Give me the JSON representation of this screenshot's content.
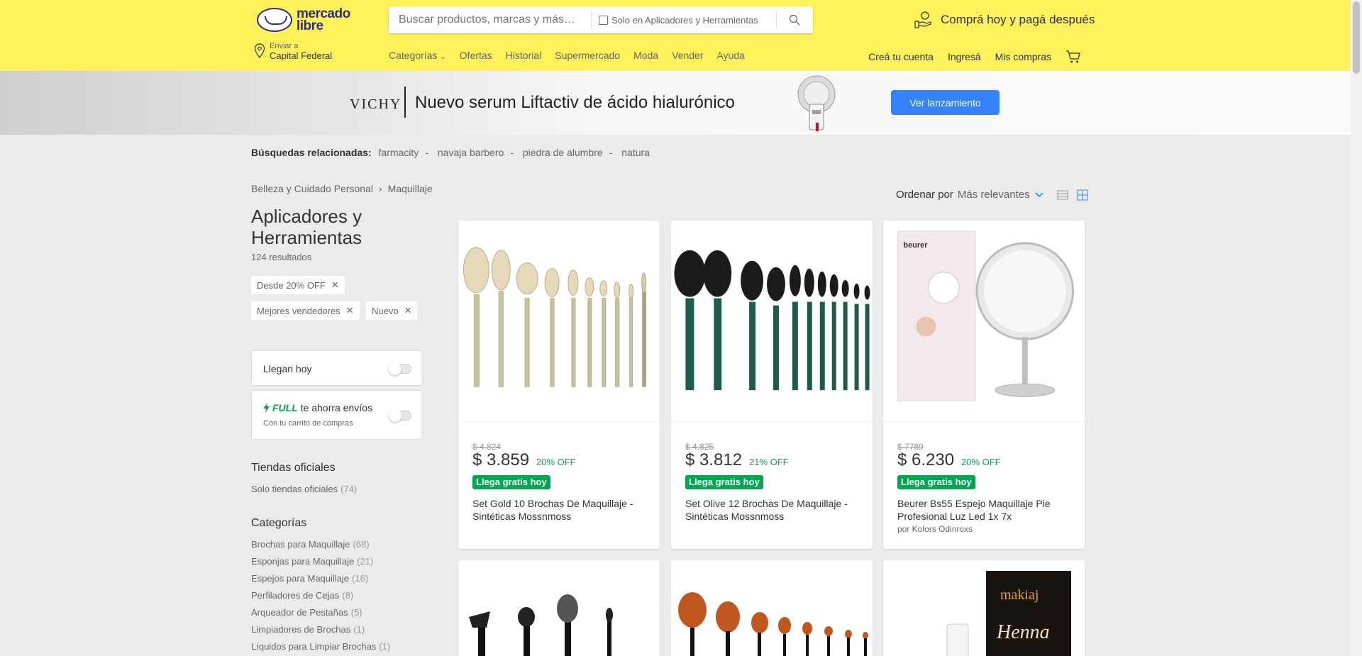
{
  "header": {
    "logo_text_1": "mercado",
    "logo_text_2": "libre",
    "search_placeholder": "Buscar productos, marcas y más…",
    "search_scope_label": "Solo en Aplicadores y Herramientas",
    "promo_text": "Comprá hoy y pagá después",
    "location_small": "Enviar a",
    "location_big": "Capital Federal",
    "nav": [
      "Categorías",
      "Ofertas",
      "Historial",
      "Supermercado",
      "Moda",
      "Vender",
      "Ayuda"
    ],
    "account": [
      "Creá tu cuenta",
      "Ingresá",
      "Mis compras"
    ]
  },
  "banner": {
    "brand": "VICHY",
    "title": "Nuevo serum Liftactiv de ácido hialurónico",
    "button": "Ver lanzamiento",
    "accent": "#3483fa"
  },
  "related": {
    "label": "Búsquedas relacionadas:",
    "items": [
      "farmacity",
      "navaja barbero",
      "piedra de alumbre",
      "natura"
    ]
  },
  "breadcrumb": [
    "Belleza y Cuidado Personal",
    "Maquillaje"
  ],
  "sort": {
    "label": "Ordenar por",
    "value": "Más relevantes"
  },
  "sidebar": {
    "title": "Aplicadores y Herramientas",
    "count": "124 resultados",
    "filters": [
      "Desde 20% OFF",
      "Mejores vendedores",
      "Nuevo"
    ],
    "toggle_today": "Llegan hoy",
    "full_brand": "FULL",
    "full_text": "te ahorra envíos",
    "full_sub": "Con tu carrito de compras",
    "stores_title": "Tiendas oficiales",
    "stores_item": "Solo tiendas oficiales",
    "stores_count": "(74)",
    "cat_title": "Categorías",
    "categories": [
      {
        "name": "Brochas para Maquillaje",
        "count": "(68)"
      },
      {
        "name": "Esponjas para Maquillaje",
        "count": "(21)"
      },
      {
        "name": "Espejos para Maquillaje",
        "count": "(16)"
      },
      {
        "name": "Perfiladores de Cejas",
        "count": "(8)"
      },
      {
        "name": "Arqueador de Pestañas",
        "count": "(5)"
      },
      {
        "name": "Limpiadores de Brochas",
        "count": "(1)"
      },
      {
        "name": "Líquidos para Limpiar Brochas",
        "count": "(1)"
      }
    ]
  },
  "products": [
    {
      "old": "$ 4.824",
      "price": "$ 3.859",
      "off": "20% OFF",
      "shipping": "Llega gratis hoy",
      "title": "Set Gold 10 Brochas De Maquillaje - Sintéticas Mossnmoss",
      "seller": ""
    },
    {
      "old": "$ 4.825",
      "price": "$ 3.812",
      "off": "21% OFF",
      "shipping": "Llega gratis hoy",
      "title": "Set Olive 12 Brochas De Maquillaje - Sintéticas Mossnmoss",
      "seller": ""
    },
    {
      "old": "$ 7789",
      "price": "$ 6.230",
      "off": "20% OFF",
      "shipping": "Llega gratis hoy",
      "title": "Beurer Bs55 Espejo Maquillaje Pie Profesional Luz Led 1x 7x",
      "seller": "por Kolors Odinroxs"
    }
  ],
  "product_images": {
    "mirror_box_brand": "beurer",
    "henna_brand": "makiaj",
    "henna_title": "Henna"
  }
}
